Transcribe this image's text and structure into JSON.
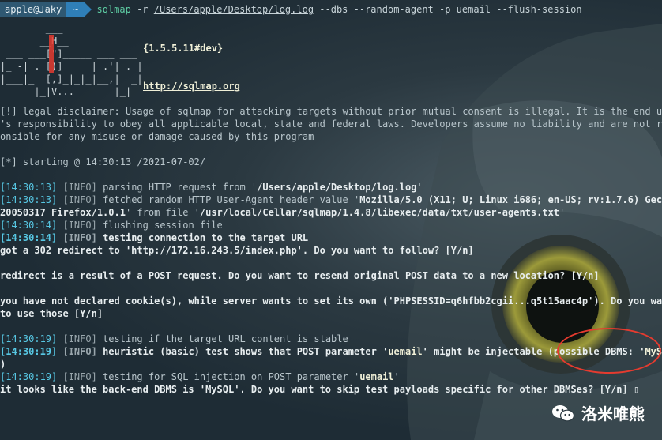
{
  "prompt": {
    "user": "apple@Jaky",
    "dir": "~",
    "command_bin": "sqlmap",
    "command_pre": " -r ",
    "command_path": "/Users/apple/Desktop/log.log",
    "command_post": " --dbs --random-agent -p uemail --flush-session"
  },
  "banner": {
    "ascii": "        ___\n       __H__\n ___ ___[\"]_____ ___ ___  \n|_ -| . [)]     | .'| . |\n|___|_  [,]_|_|_|__,|  _|\n      |_|V...       |_|   ",
    "version": "{1.5.5.11#dev}",
    "url": "http://sqlmap.org"
  },
  "disclaimer": [
    "[!] legal disclaimer: Usage of sqlmap for attacking targets without prior mutual consent is illegal. It is the end user",
    "'s responsibility to obey all applicable local, state and federal laws. Developers assume no liability and are not resp",
    "onsible for any misuse or damage caused by this program"
  ],
  "starting": "[*] starting @ 14:30:13 /2021-07-02/",
  "log": {
    "l1_time": "[14:30:13]",
    "l1_level": "[INFO]",
    "l1_text": " parsing HTTP request from '",
    "l1_path": "/Users/apple/Desktop/log.log",
    "l1_end": "'",
    "l2_time": "[14:30:13]",
    "l2_level": "[INFO]",
    "l2_text": " fetched random HTTP User-Agent header value '",
    "l2_ua": "Mozilla/5.0 (X11; U; Linux i686; en-US; rv:1.7.6) Gecko/",
    "l3_ua": "20050317 Firefox/1.0.1",
    "l3_text": "' from file '",
    "l3_path": "/usr/local/Cellar/sqlmap/1.4.8/libexec/data/txt/user-agents.txt",
    "l3_end": "'",
    "l4_time": "[14:30:14]",
    "l4_level": "[INFO]",
    "l4_text": " flushing session file",
    "l5_time": "[14:30:14]",
    "l5_level": "[INFO]",
    "l5_text": " testing connection to the target URL",
    "l6_text": "got a 302 redirect to 'http://172.16.243.5/index.php'. Do you want to follow? [Y/n]",
    "l7_text": "redirect is a result of a POST request. Do you want to resend original POST data to a new location? [Y/n]",
    "l8_text": "you have not declared cookie(s), while server wants to set its own ('PHPSESSID=q6hfbb2cgii...q5t15aac4p'). Do you want",
    "l9_text": "to use those [Y/n]",
    "l10_time": "[14:30:19]",
    "l10_level": "[INFO]",
    "l10_text": " testing if the target URL content is stable",
    "l11_time": "[14:30:19]",
    "l11_level": "[INFO]",
    "l11_text": " heuristic (basic) test shows that POST parameter '",
    "l11_param": "uemail",
    "l11_text2": "' might be injectable (possible DBMS: '",
    "l11_dbms": "MySQL",
    "l11_end": "'",
    "l12_text": ")",
    "l13_time": "[14:30:19]",
    "l13_level": "[INFO]",
    "l13_text": " testing for SQL injection on POST parameter '",
    "l13_param": "uemail",
    "l13_end": "'",
    "l14_text": "it looks like the back-end DBMS is 'MySQL'. Do you want to skip test payloads specific for other DBMSes? [Y/n] ",
    "cursor": "▯"
  },
  "watermark": {
    "text": "洛米唯熊",
    "icon": "wechat-icon"
  },
  "colors": {
    "timestamp": "#57c7e3",
    "highlight_circle": "#e53b2f",
    "banner_bar": "#e53b2f"
  }
}
